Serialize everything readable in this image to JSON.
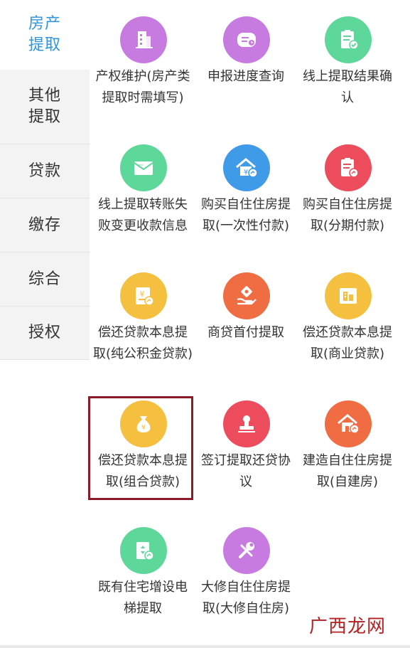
{
  "sidebar": {
    "items": [
      {
        "label": "房产提取",
        "active": true
      },
      {
        "label": "其他提取"
      },
      {
        "label": "贷款"
      },
      {
        "label": "缴存"
      },
      {
        "label": "综合"
      },
      {
        "label": "授权"
      }
    ]
  },
  "grid": {
    "items": [
      {
        "label": "产权维护(房产类提取时需填写)",
        "icon": "building-icon",
        "color": "#c77be0"
      },
      {
        "label": "申报进度查询",
        "icon": "progress-query-icon",
        "color": "#c77be0"
      },
      {
        "label": "线上提取结果确认",
        "icon": "clipboard-check-icon",
        "color": "#5ed79a"
      },
      {
        "label": "线上提取转账失败变更收款信息",
        "icon": "envelope-icon",
        "color": "#5ed79a"
      },
      {
        "label": "购买自住住房提取(一次性付款)",
        "icon": "house-yuan-icon",
        "color": "#3f9be8"
      },
      {
        "label": "购买自住住房提取(分期付款)",
        "icon": "clipboard-installment-icon",
        "color": "#ec4c5c"
      },
      {
        "label": "偿还贷款本息提取(纯公积金贷款)",
        "icon": "yuan-card-icon",
        "color": "#f5c040"
      },
      {
        "label": "商贷首付提取",
        "icon": "hand-coin-icon",
        "color": "#f06d43"
      },
      {
        "label": "偿还贷款本息提取(商业贷款)",
        "icon": "building-card-icon",
        "color": "#f5c040"
      },
      {
        "label": "偿还贷款本息提取(组合贷款)",
        "icon": "money-bag-icon",
        "color": "#f5c040"
      },
      {
        "label": "签订提取还贷协议",
        "icon": "stamp-icon",
        "color": "#ec4c5c"
      },
      {
        "label": "建造自住住房提取(自建房)",
        "icon": "house-build-icon",
        "color": "#f06d43"
      },
      {
        "label": "既有住宅增设电梯提取",
        "icon": "elevator-icon",
        "color": "#5ed79a"
      },
      {
        "label": "大修自住住房提取(大修自住房)",
        "icon": "wrench-icon",
        "color": "#c77be0"
      }
    ]
  },
  "watermark": {
    "text": "广西龙网"
  }
}
